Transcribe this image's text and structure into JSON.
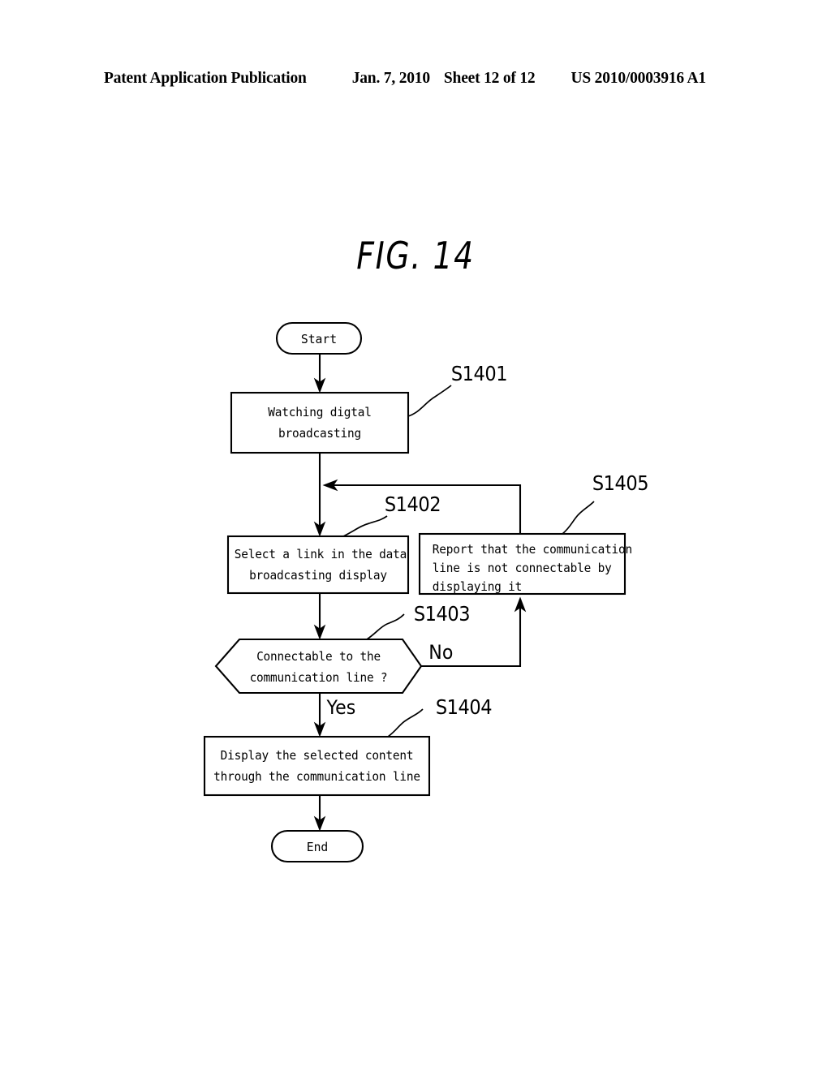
{
  "header": {
    "title": "Patent Application Publication",
    "date": "Jan. 7, 2010",
    "sheet": "Sheet 12 of 12",
    "number": "US 2010/0003916 A1"
  },
  "figure": {
    "title": "FIG. 14"
  },
  "chart_data": {
    "type": "diagram",
    "diagram_type": "flowchart",
    "title": "FIG. 14",
    "orientation": "top-to-bottom",
    "nodes": [
      {
        "id": "start",
        "shape": "terminator",
        "label": "Start",
        "step": ""
      },
      {
        "id": "s1401",
        "shape": "process",
        "label": "Watching digtal\nbroadcasting",
        "step": "S1401"
      },
      {
        "id": "s1402",
        "shape": "process",
        "label": "Select a link in the data\nbroadcasting display",
        "step": "S1402"
      },
      {
        "id": "s1403",
        "shape": "hexagon",
        "label": "Connectable to the\ncommunication line ?",
        "step": "S1403"
      },
      {
        "id": "s1404",
        "shape": "process",
        "label": "Display the selected content\nthrough the communication line",
        "step": "S1404"
      },
      {
        "id": "s1405",
        "shape": "process",
        "label": "Report that the communication\nline is not connectable by\ndisplaying it",
        "step": "S1405"
      },
      {
        "id": "end",
        "shape": "terminator",
        "label": "End",
        "step": ""
      }
    ],
    "edges": [
      {
        "from": "start",
        "to": "s1401",
        "label": ""
      },
      {
        "from": "s1401",
        "to": "s1402",
        "label": ""
      },
      {
        "from": "s1402",
        "to": "s1403",
        "label": ""
      },
      {
        "from": "s1403",
        "to": "s1404",
        "label": "Yes"
      },
      {
        "from": "s1403",
        "to": "s1405",
        "label": "No"
      },
      {
        "from": "s1405",
        "to": "s1402",
        "label": ""
      },
      {
        "from": "s1404",
        "to": "end",
        "label": ""
      }
    ]
  },
  "flow": {
    "start_label": "Start",
    "end_label": "End",
    "box_s1401_line1": "Watching digtal",
    "box_s1401_line2": "broadcasting",
    "box_s1402_line1": "Select a link in the data",
    "box_s1402_line2": "broadcasting display",
    "hex_s1403_line1": "Connectable to the",
    "hex_s1403_line2": "communication line ?",
    "box_s1404_line1": "Display the selected content",
    "box_s1404_line2": "through the communication line",
    "box_s1405_line1": "Report that the communication",
    "box_s1405_line2": "line is not connectable by",
    "box_s1405_line3": "displaying it",
    "step_s1401": "S1401",
    "step_s1402": "S1402",
    "step_s1403": "S1403",
    "step_s1404": "S1404",
    "step_s1405": "S1405",
    "branch_yes": "Yes",
    "branch_no": "No"
  },
  "colors": {
    "ink": "#000000",
    "paper": "#ffffff"
  }
}
